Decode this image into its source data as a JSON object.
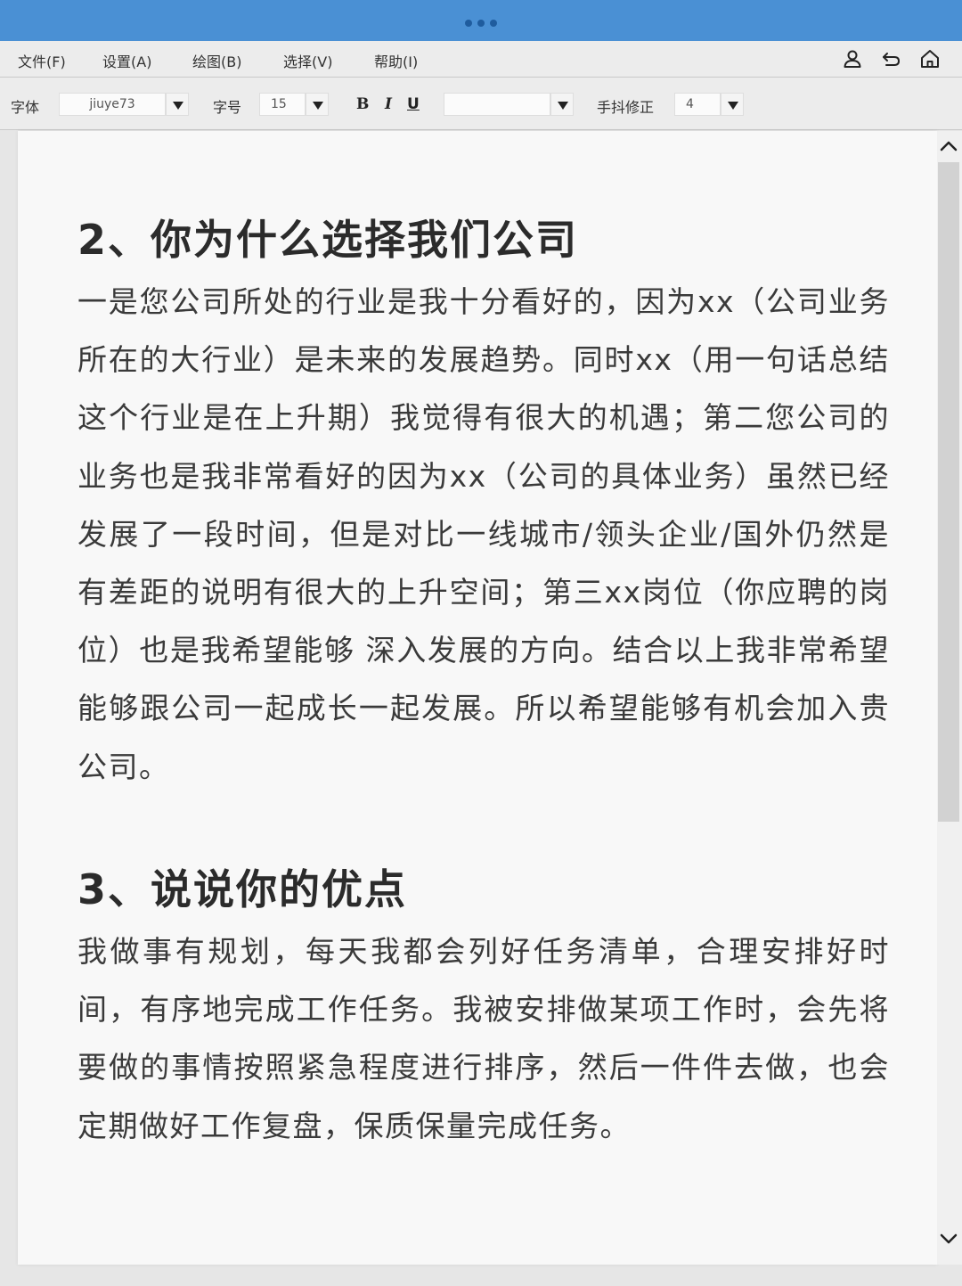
{
  "menu": {
    "file": "文件(F)",
    "settings": "设置(A)",
    "draw": "绘图(B)",
    "select": "选择(V)",
    "help": "帮助(I)"
  },
  "toolbar": {
    "font_label": "字体",
    "font_value": "jiuye73",
    "size_label": "字号",
    "size_value": "15",
    "bold": "B",
    "italic": "I",
    "underline": "U",
    "color_value": "",
    "jitter_label": "手抖修正",
    "jitter_value": "4"
  },
  "document": {
    "section1_title": "2、你为什么选择我们公司",
    "section1_body": "一是您公司所处的行业是我十分看好的，因为xx（公司业务所在的大行业）是未来的发展趋势。同时xx（用一句话总结这个行业是在上升期）我觉得有很大的机遇；第二您公司的业务也是我非常看好的因为xx（公司的具体业务）虽然已经发展了一段时间，但是对比一线城市/领头企业/国外仍然是有差距的说明有很大的上升空间；第三xx岗位（你应聘的岗位）也是我希望能够 深入发展的方向。结合以上我非常希望能够跟公司一起成长一起发展。所以希望能够有机会加入贵公司。",
    "section2_title": "3、说说你的优点",
    "section2_body": "我做事有规划，每天我都会列好任务清单，合理安排好时间，有序地完成工作任务。我被安排做某项工作时，会先将要做的事情按照紧急程度进行排序，然后一件件去做，也会定期做好工作复盘，保质保量完成任务。"
  },
  "colors": {
    "titlebar": "#4a90d4",
    "toolbar_bg": "#ececec",
    "page_bg": "#f8f8f8"
  },
  "icons": [
    "user-icon",
    "undo-icon",
    "home-icon",
    "dropdown-arrow-icon",
    "scroll-up-icon",
    "scroll-down-icon"
  ]
}
